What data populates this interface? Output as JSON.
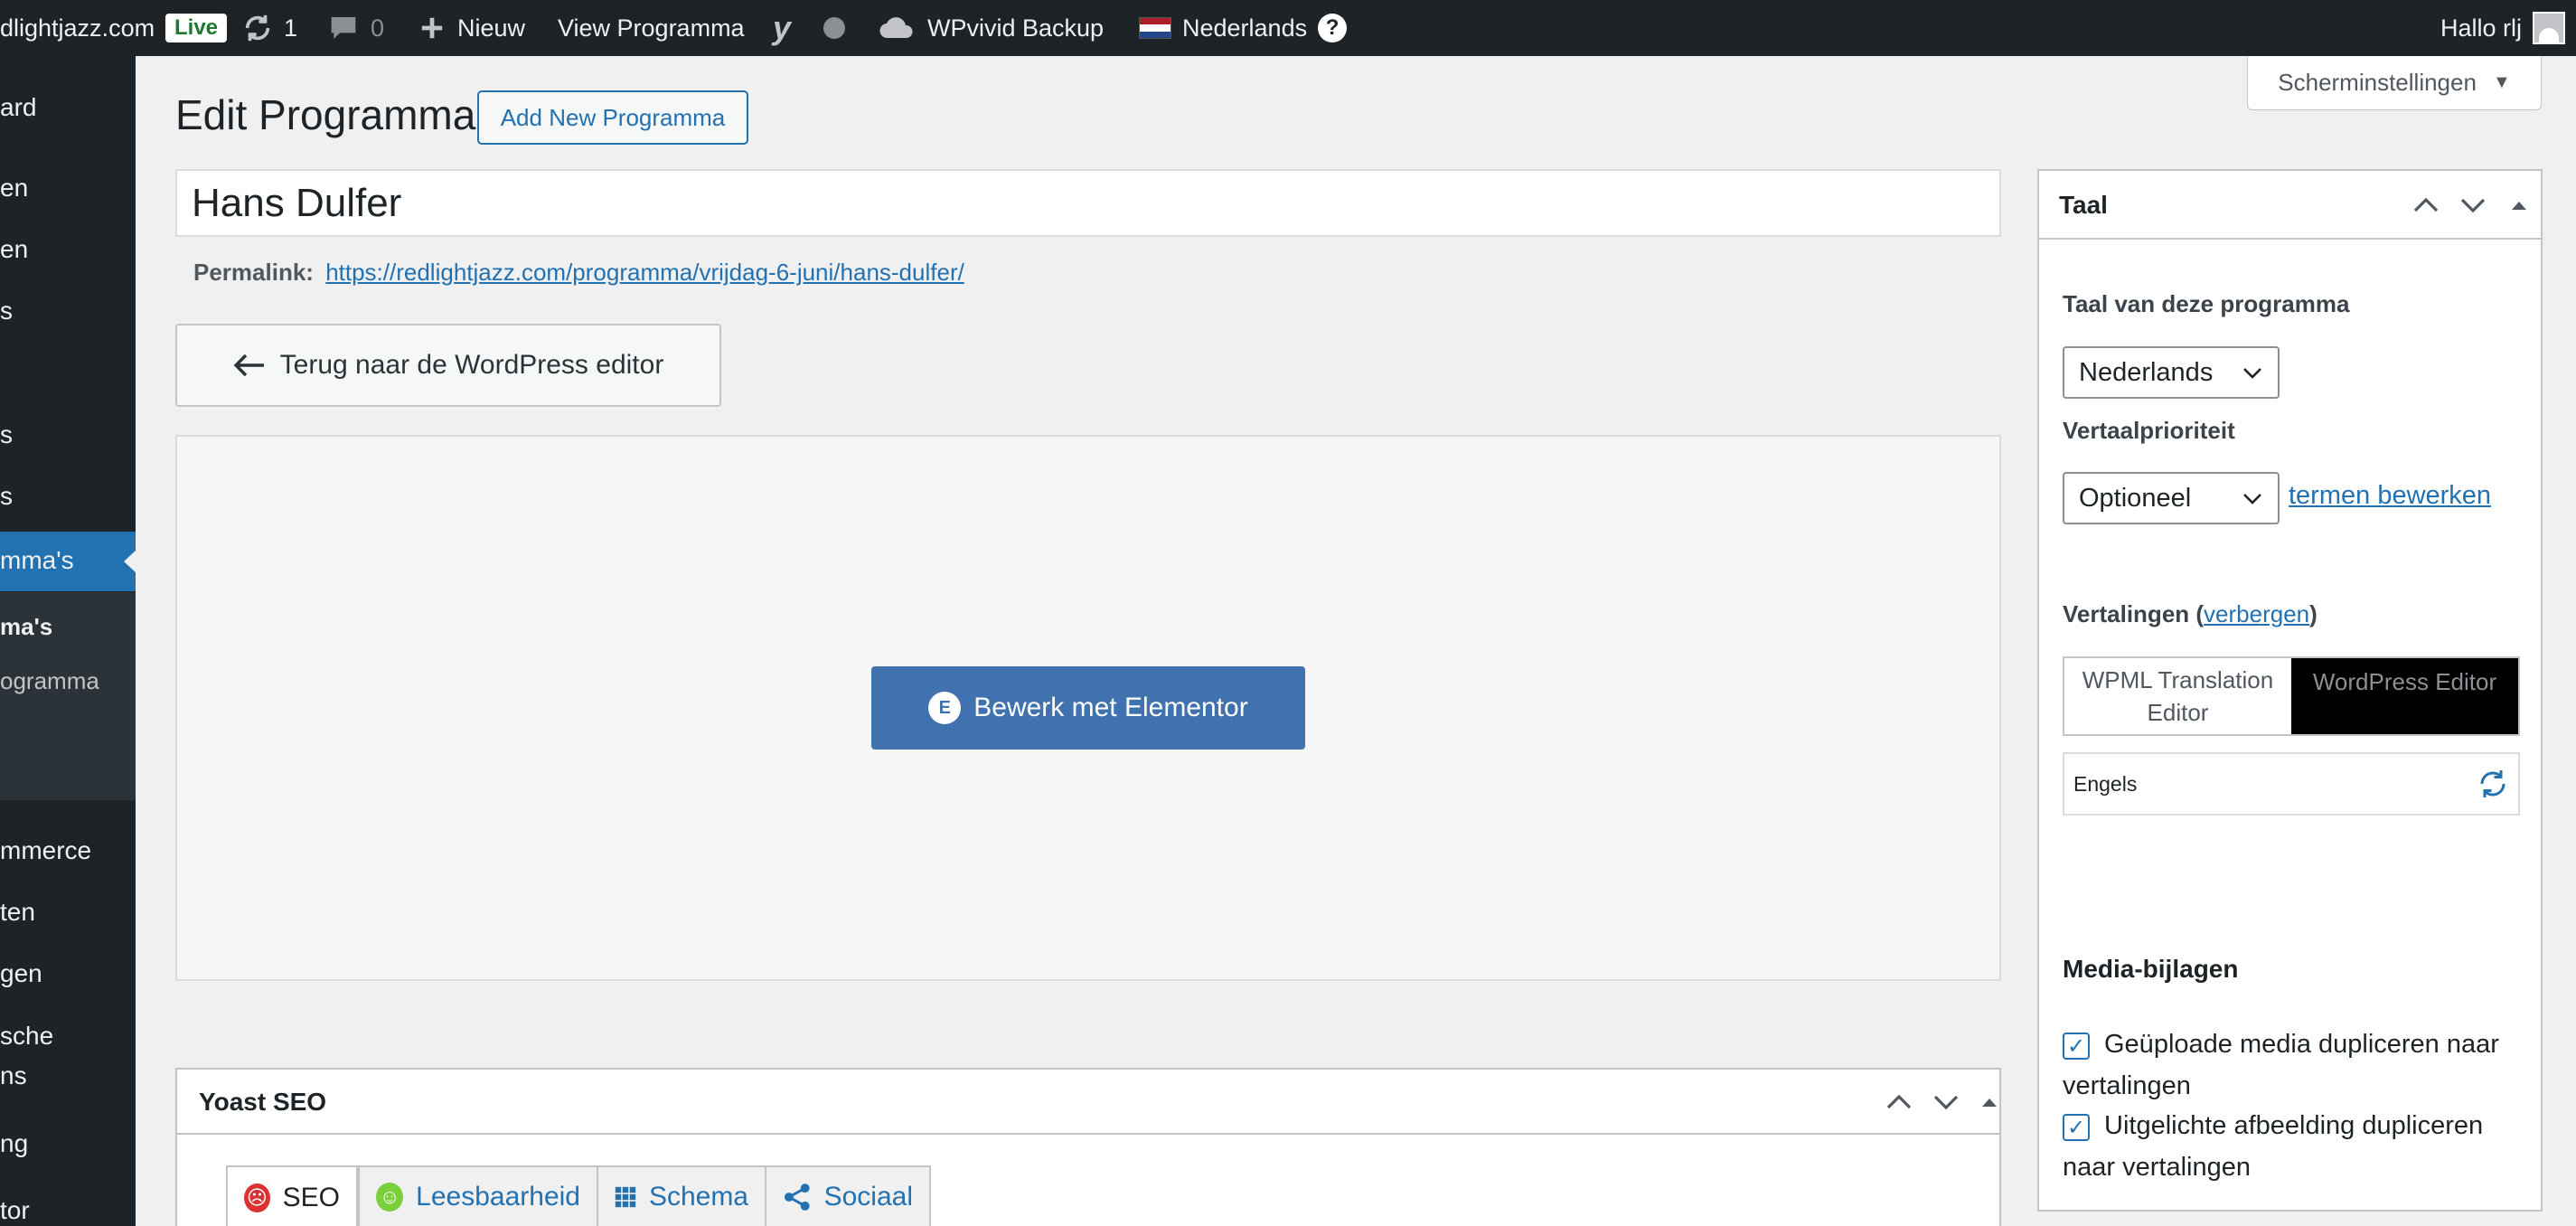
{
  "adminbar": {
    "site": "dlightjazz.com",
    "live": "Live",
    "updates_count": "1",
    "comments_count": "0",
    "new_label": "Nieuw",
    "view_label": "View Programma",
    "backup_label": "WPvivid Backup",
    "language_label": "Nederlands",
    "help_icon": "?",
    "greeting": "Hallo rlj"
  },
  "sidebar": {
    "items": [
      "ard",
      "en",
      "en",
      "s",
      "s",
      "s",
      "mma's",
      "ma's",
      "ogramma",
      "mmerce",
      "ten",
      "gen",
      "sche",
      "ns",
      "ng",
      "tor"
    ]
  },
  "page": {
    "title": "Edit Programma",
    "add_new": "Add New Programma",
    "screen_options": "Scherminstellingen",
    "post_title": "Hans Dulfer",
    "permalink_label": "Permalink:",
    "permalink_url": "https://redlightjazz.com/programma/vrijdag-6-juni/hans-dulfer/",
    "back_button": "Terug naar de WordPress editor",
    "elementor_button": "Bewerk met Elementor"
  },
  "yoast": {
    "title": "Yoast SEO",
    "tabs": [
      "SEO",
      "Leesbaarheid",
      "Schema",
      "Sociaal"
    ]
  },
  "language_panel": {
    "title": "Taal",
    "language_label": "Taal van deze programma",
    "language_value": "Nederlands",
    "priority_label": "Vertaalprioriteit",
    "priority_value": "Optioneel",
    "edit_terms": "termen bewerken",
    "translations_label": "Vertalingen (",
    "translations_hide": "verbergen",
    "translations_close": ")",
    "editor_wpml": "WPML Translation Editor",
    "editor_wp": "WordPress Editor",
    "lang_english": "Engels",
    "media_label": "Media-bijlagen",
    "media_option1": "Geüploade media dupliceren naar vertalingen",
    "media_option2": "Uitgelichte afbeelding dupliceren naar vertalingen"
  },
  "colors": {
    "admin_dark": "#1d2327",
    "accent_blue": "#2271b1",
    "elementor_blue": "#3f72af"
  }
}
